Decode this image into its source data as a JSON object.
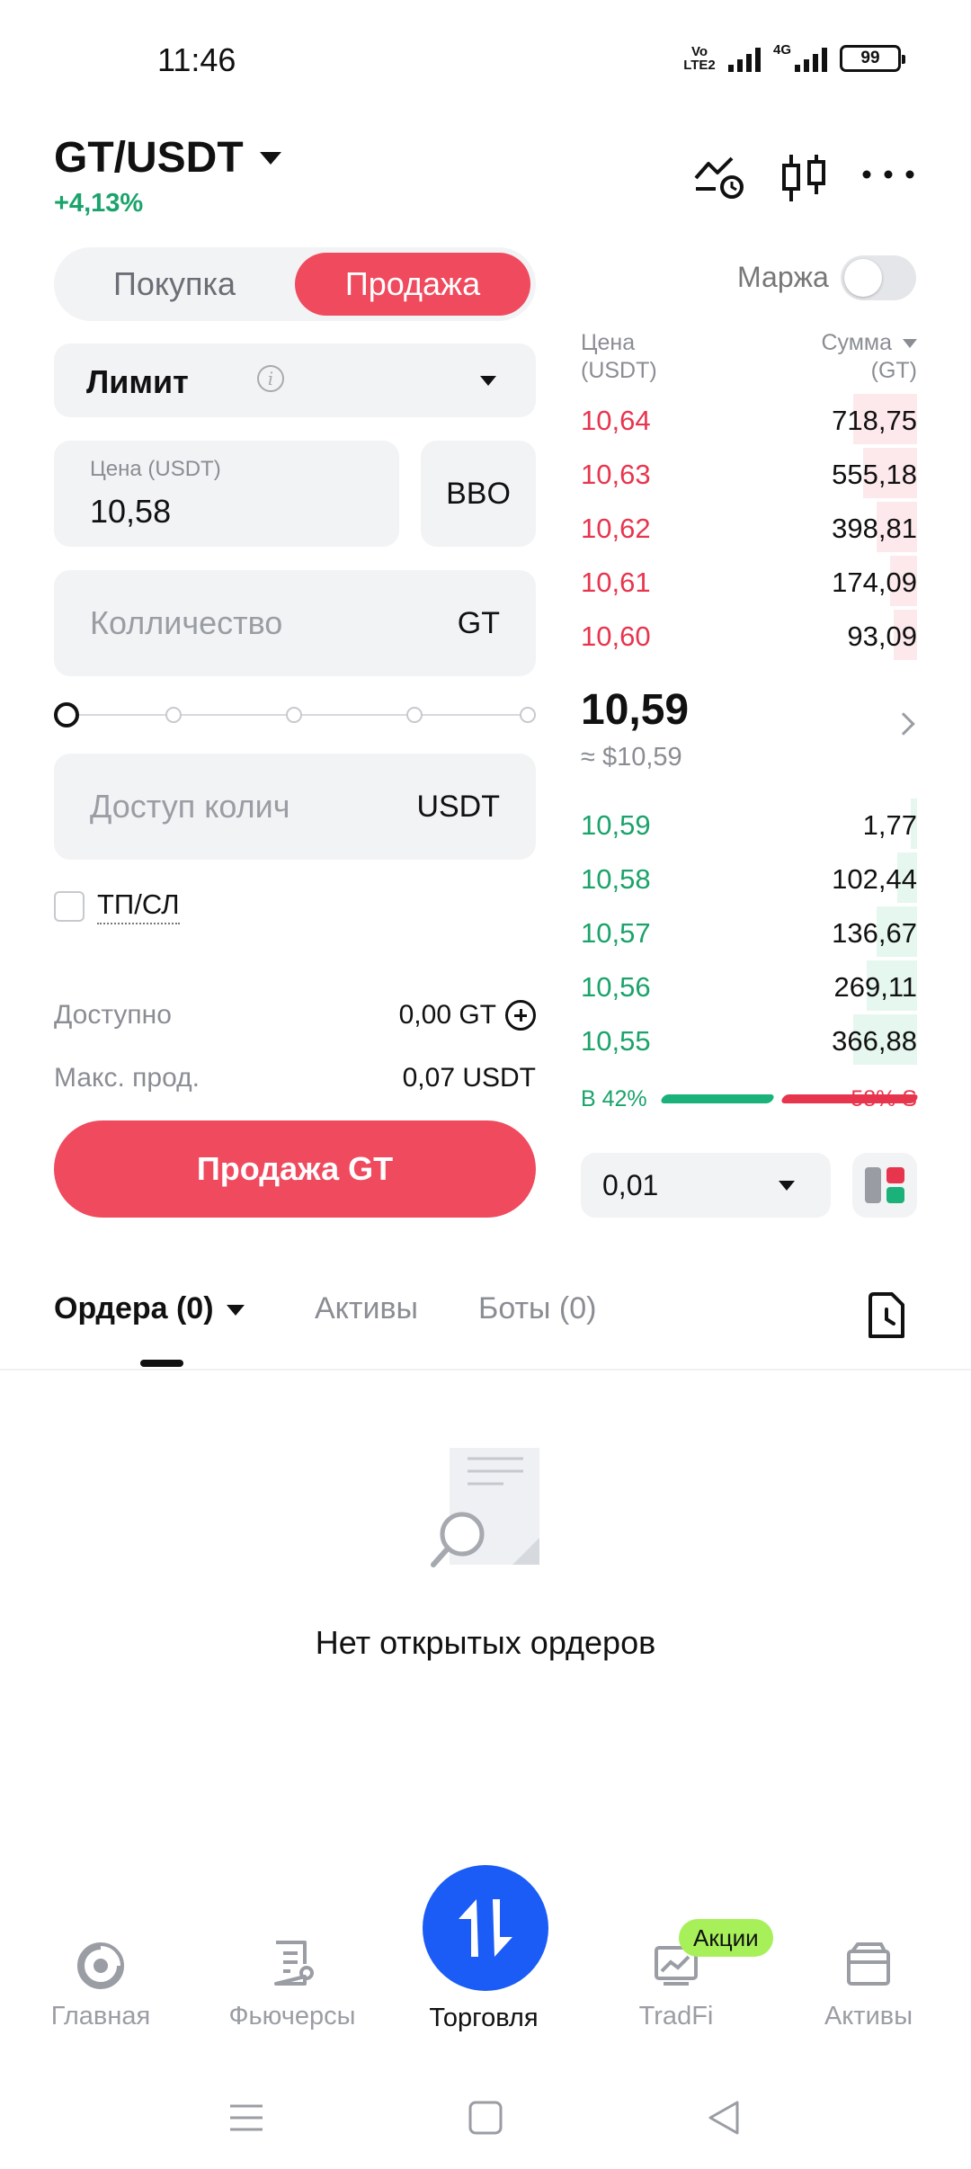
{
  "status_bar": {
    "time": "11:46",
    "volte": "VoLTE2",
    "network": "4G",
    "battery": "99"
  },
  "header": {
    "pair": "GT/USDT",
    "change": "+4,13%",
    "icons": [
      "price-alert-icon",
      "candlestick-chart-icon",
      "more-icon"
    ]
  },
  "trade_form": {
    "buy_tab": "Покупка",
    "sell_tab": "Продажа",
    "margin_label": "Маржа",
    "margin_enabled": false,
    "order_type": "Лимит",
    "price_label": "Цена (USDT)",
    "price_value": "10,58",
    "bbo_label": "BBO",
    "quantity_placeholder": "Колличество",
    "quantity_unit": "GT",
    "slider_value_percent": 0,
    "amount_placeholder": "Доступ колич",
    "amount_unit": "USDT",
    "tpsl_label": "ТП/СЛ",
    "tpsl_checked": false,
    "available_label": "Доступно",
    "available_value": "0,00 GT",
    "max_sell_label": "Макс. прод.",
    "max_sell_value": "0,07 USDT",
    "submit_label": "Продажа GT"
  },
  "order_book": {
    "price_header": "Цена",
    "price_header_unit": "(USDT)",
    "amount_header": "Сумма",
    "amount_header_unit": "(GT)",
    "asks": [
      {
        "price": "10,64",
        "amount": "718,75",
        "depth": 0.19
      },
      {
        "price": "10,63",
        "amount": "555,18",
        "depth": 0.16
      },
      {
        "price": "10,62",
        "amount": "398,81",
        "depth": 0.12
      },
      {
        "price": "10,61",
        "amount": "174,09",
        "depth": 0.08
      },
      {
        "price": "10,60",
        "amount": "93,09",
        "depth": 0.07
      }
    ],
    "last_price": "10,59",
    "last_price_usd": "≈ $10,59",
    "bids": [
      {
        "price": "10,59",
        "amount": "1,77",
        "depth": 0.02
      },
      {
        "price": "10,58",
        "amount": "102,44",
        "depth": 0.06
      },
      {
        "price": "10,57",
        "amount": "136,67",
        "depth": 0.12
      },
      {
        "price": "10,56",
        "amount": "269,11",
        "depth": 0.15
      },
      {
        "price": "10,55",
        "amount": "366,88",
        "depth": 0.19
      }
    ],
    "buy_ratio": "B 42%",
    "sell_ratio": "58% S",
    "depth_step": "0,01",
    "colors": {
      "ask": "#e8354e",
      "bid": "#1aa36b",
      "accent": "#f04a5e",
      "brand": "#1a5cf5"
    }
  },
  "orders_panel": {
    "tabs": [
      "Ордера (0)",
      "Активы",
      "Боты (0)"
    ],
    "empty_text": "Нет открытых ордеров"
  },
  "bottom_nav": {
    "items": [
      {
        "label": "Главная",
        "icon": "home-icon"
      },
      {
        "label": "Фьючерсы",
        "icon": "futures-icon"
      },
      {
        "label": "Торговля",
        "icon": "trade-icon",
        "active": true
      },
      {
        "label": "TradFi",
        "icon": "tradfi-icon",
        "badge": "Акции"
      },
      {
        "label": "Активы",
        "icon": "wallet-icon"
      }
    ]
  }
}
